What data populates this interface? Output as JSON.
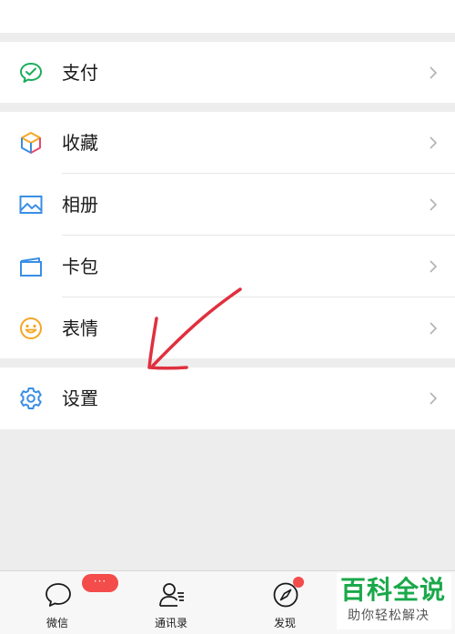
{
  "menu": {
    "payment": {
      "label": "支付",
      "icon": "wechat-pay-icon"
    },
    "favorites": {
      "label": "收藏",
      "icon": "cube-icon"
    },
    "album": {
      "label": "相册",
      "icon": "image-icon"
    },
    "cards": {
      "label": "卡包",
      "icon": "card-wallet-icon"
    },
    "stickers": {
      "label": "表情",
      "icon": "smiley-icon"
    },
    "settings": {
      "label": "设置",
      "icon": "gear-icon"
    }
  },
  "tabbar": {
    "tabs": [
      {
        "label": "微信",
        "icon": "chat-bubble-icon",
        "badge": "···"
      },
      {
        "label": "通讯录",
        "icon": "contacts-icon"
      },
      {
        "label": "发现",
        "icon": "compass-icon",
        "dot": true
      }
    ]
  },
  "watermark": {
    "title": "百科全说",
    "subtitle": "助你轻松解决"
  },
  "colors": {
    "accent_green": "#19a84a",
    "badge_red": "#f44b4b",
    "annotation_red": "#e0303e"
  }
}
